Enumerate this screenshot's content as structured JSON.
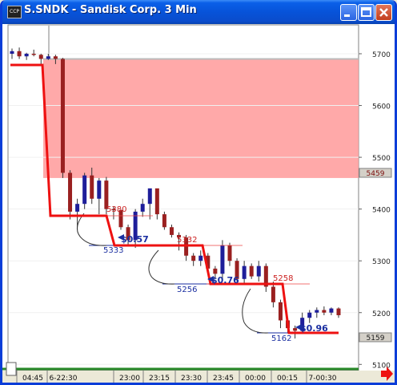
{
  "window": {
    "title": "S.SNDK - Sandisk Corp. 3 Min",
    "icon_label": "CCP",
    "controls": [
      "minimize",
      "maximize",
      "close"
    ]
  },
  "chart": {
    "price_axis_labels": [
      "5700",
      "5600",
      "5500",
      "5400",
      "5300",
      "5200",
      "5100"
    ],
    "price_flags": [
      "5459",
      "5159"
    ],
    "time_labels": [
      "04:45",
      "6-22:30",
      "23:00",
      "23:15",
      "23:30",
      "23:45",
      "00:00",
      "00:15",
      "7-00:30"
    ],
    "level_labels": [
      "5380",
      "5333",
      "5332",
      "5256",
      "5258",
      "5162"
    ],
    "profit_labels": [
      "$0.57",
      "$0.76",
      "$0.96"
    ],
    "colors": {
      "up": "#1e1e9a",
      "down": "#9a2020",
      "stop": "#ee1111",
      "zone": "#ff9a9a",
      "profit": "#1a2ea0",
      "flag_bg": "#d4d0c8"
    }
  },
  "chart_data": {
    "type": "candlestick",
    "y_range": [
      5100,
      5750
    ],
    "ohlc": [
      [
        5700,
        5710,
        5690,
        5705
      ],
      [
        5705,
        5712,
        5690,
        5695
      ],
      [
        5695,
        5702,
        5688,
        5700
      ],
      [
        5700,
        5708,
        5695,
        5698
      ],
      [
        5698,
        5700,
        5680,
        5690
      ],
      [
        5690,
        5700,
        5688,
        5695
      ],
      [
        5695,
        5698,
        5680,
        5690
      ],
      [
        5690,
        5692,
        5460,
        5470
      ],
      [
        5470,
        5475,
        5380,
        5395
      ],
      [
        5395,
        5420,
        5360,
        5410
      ],
      [
        5410,
        5470,
        5400,
        5465
      ],
      [
        5465,
        5480,
        5410,
        5420
      ],
      [
        5420,
        5460,
        5390,
        5455
      ],
      [
        5455,
        5462,
        5390,
        5400
      ],
      [
        5400,
        5405,
        5380,
        5398
      ],
      [
        5398,
        5400,
        5360,
        5365
      ],
      [
        5365,
        5370,
        5330,
        5340
      ],
      [
        5340,
        5400,
        5325,
        5395
      ],
      [
        5395,
        5420,
        5385,
        5410
      ],
      [
        5410,
        5425,
        5380,
        5440
      ],
      [
        5440,
        5430,
        5380,
        5390
      ],
      [
        5390,
        5395,
        5360,
        5365
      ],
      [
        5365,
        5370,
        5345,
        5350
      ],
      [
        5350,
        5355,
        5320,
        5345
      ],
      [
        5345,
        5350,
        5300,
        5310
      ],
      [
        5310,
        5315,
        5290,
        5300
      ],
      [
        5300,
        5320,
        5290,
        5310
      ],
      [
        5310,
        5315,
        5280,
        5285
      ],
      [
        5285,
        5290,
        5265,
        5275
      ],
      [
        5275,
        5340,
        5265,
        5330
      ],
      [
        5330,
        5335,
        5290,
        5300
      ],
      [
        5300,
        5305,
        5260,
        5265
      ],
      [
        5265,
        5300,
        5255,
        5290
      ],
      [
        5290,
        5295,
        5265,
        5270
      ],
      [
        5270,
        5300,
        5260,
        5290
      ],
      [
        5290,
        5295,
        5240,
        5250
      ],
      [
        5250,
        5260,
        5210,
        5220
      ],
      [
        5220,
        5225,
        5170,
        5185
      ],
      [
        5185,
        5190,
        5160,
        5170
      ],
      [
        5170,
        5175,
        5150,
        5165
      ],
      [
        5165,
        5200,
        5160,
        5190
      ],
      [
        5190,
        5205,
        5180,
        5200
      ],
      [
        5200,
        5210,
        5190,
        5205
      ],
      [
        5205,
        5212,
        5195,
        5200
      ],
      [
        5200,
        5210,
        5195,
        5208
      ],
      [
        5208,
        5210,
        5190,
        5195
      ]
    ],
    "stop_level_steps": [
      5680,
      5390,
      5330,
      5260,
      5158
    ],
    "resistance_zone": [
      5460,
      5690
    ],
    "annotations": [
      {
        "label": "5380",
        "level": 5380
      },
      {
        "label": "5333",
        "level": 5333
      },
      {
        "label": "5332",
        "level": 5332
      },
      {
        "label": "5256",
        "level": 5256
      },
      {
        "label": "5258",
        "level": 5258
      },
      {
        "label": "5162",
        "level": 5162
      }
    ]
  }
}
